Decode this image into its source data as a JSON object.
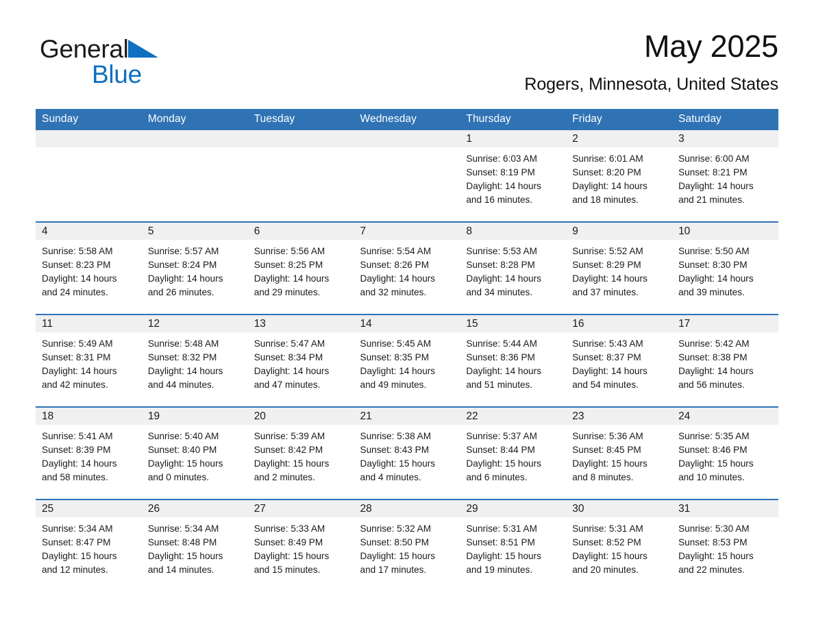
{
  "brand": {
    "name_part1": "General",
    "name_part2": "Blue",
    "triangle_color": "#0f6fc0",
    "text_color": "#1a1a1a"
  },
  "header": {
    "title": "May 2025",
    "subtitle": "Rogers, Minnesota, United States"
  },
  "theme": {
    "header_blue": "#3073b5",
    "row_rule_blue": "#2e72b5",
    "daynum_band": "#f0f0f0",
    "text": "#1a1a1a"
  },
  "weekday_headers": [
    "Sunday",
    "Monday",
    "Tuesday",
    "Wednesday",
    "Thursday",
    "Friday",
    "Saturday"
  ],
  "labels": {
    "sunrise_prefix": "Sunrise:",
    "sunset_prefix": "Sunset:",
    "daylight_prefix": "Daylight:"
  },
  "weeks": [
    [
      {
        "day": "",
        "sunrise": "",
        "sunset": "",
        "daylight_line1": "",
        "daylight_line2": ""
      },
      {
        "day": "",
        "sunrise": "",
        "sunset": "",
        "daylight_line1": "",
        "daylight_line2": ""
      },
      {
        "day": "",
        "sunrise": "",
        "sunset": "",
        "daylight_line1": "",
        "daylight_line2": ""
      },
      {
        "day": "",
        "sunrise": "",
        "sunset": "",
        "daylight_line1": "",
        "daylight_line2": ""
      },
      {
        "day": "1",
        "sunrise": "Sunrise: 6:03 AM",
        "sunset": "Sunset: 8:19 PM",
        "daylight_line1": "Daylight: 14 hours",
        "daylight_line2": "and 16 minutes."
      },
      {
        "day": "2",
        "sunrise": "Sunrise: 6:01 AM",
        "sunset": "Sunset: 8:20 PM",
        "daylight_line1": "Daylight: 14 hours",
        "daylight_line2": "and 18 minutes."
      },
      {
        "day": "3",
        "sunrise": "Sunrise: 6:00 AM",
        "sunset": "Sunset: 8:21 PM",
        "daylight_line1": "Daylight: 14 hours",
        "daylight_line2": "and 21 minutes."
      }
    ],
    [
      {
        "day": "4",
        "sunrise": "Sunrise: 5:58 AM",
        "sunset": "Sunset: 8:23 PM",
        "daylight_line1": "Daylight: 14 hours",
        "daylight_line2": "and 24 minutes."
      },
      {
        "day": "5",
        "sunrise": "Sunrise: 5:57 AM",
        "sunset": "Sunset: 8:24 PM",
        "daylight_line1": "Daylight: 14 hours",
        "daylight_line2": "and 26 minutes."
      },
      {
        "day": "6",
        "sunrise": "Sunrise: 5:56 AM",
        "sunset": "Sunset: 8:25 PM",
        "daylight_line1": "Daylight: 14 hours",
        "daylight_line2": "and 29 minutes."
      },
      {
        "day": "7",
        "sunrise": "Sunrise: 5:54 AM",
        "sunset": "Sunset: 8:26 PM",
        "daylight_line1": "Daylight: 14 hours",
        "daylight_line2": "and 32 minutes."
      },
      {
        "day": "8",
        "sunrise": "Sunrise: 5:53 AM",
        "sunset": "Sunset: 8:28 PM",
        "daylight_line1": "Daylight: 14 hours",
        "daylight_line2": "and 34 minutes."
      },
      {
        "day": "9",
        "sunrise": "Sunrise: 5:52 AM",
        "sunset": "Sunset: 8:29 PM",
        "daylight_line1": "Daylight: 14 hours",
        "daylight_line2": "and 37 minutes."
      },
      {
        "day": "10",
        "sunrise": "Sunrise: 5:50 AM",
        "sunset": "Sunset: 8:30 PM",
        "daylight_line1": "Daylight: 14 hours",
        "daylight_line2": "and 39 minutes."
      }
    ],
    [
      {
        "day": "11",
        "sunrise": "Sunrise: 5:49 AM",
        "sunset": "Sunset: 8:31 PM",
        "daylight_line1": "Daylight: 14 hours",
        "daylight_line2": "and 42 minutes."
      },
      {
        "day": "12",
        "sunrise": "Sunrise: 5:48 AM",
        "sunset": "Sunset: 8:32 PM",
        "daylight_line1": "Daylight: 14 hours",
        "daylight_line2": "and 44 minutes."
      },
      {
        "day": "13",
        "sunrise": "Sunrise: 5:47 AM",
        "sunset": "Sunset: 8:34 PM",
        "daylight_line1": "Daylight: 14 hours",
        "daylight_line2": "and 47 minutes."
      },
      {
        "day": "14",
        "sunrise": "Sunrise: 5:45 AM",
        "sunset": "Sunset: 8:35 PM",
        "daylight_line1": "Daylight: 14 hours",
        "daylight_line2": "and 49 minutes."
      },
      {
        "day": "15",
        "sunrise": "Sunrise: 5:44 AM",
        "sunset": "Sunset: 8:36 PM",
        "daylight_line1": "Daylight: 14 hours",
        "daylight_line2": "and 51 minutes."
      },
      {
        "day": "16",
        "sunrise": "Sunrise: 5:43 AM",
        "sunset": "Sunset: 8:37 PM",
        "daylight_line1": "Daylight: 14 hours",
        "daylight_line2": "and 54 minutes."
      },
      {
        "day": "17",
        "sunrise": "Sunrise: 5:42 AM",
        "sunset": "Sunset: 8:38 PM",
        "daylight_line1": "Daylight: 14 hours",
        "daylight_line2": "and 56 minutes."
      }
    ],
    [
      {
        "day": "18",
        "sunrise": "Sunrise: 5:41 AM",
        "sunset": "Sunset: 8:39 PM",
        "daylight_line1": "Daylight: 14 hours",
        "daylight_line2": "and 58 minutes."
      },
      {
        "day": "19",
        "sunrise": "Sunrise: 5:40 AM",
        "sunset": "Sunset: 8:40 PM",
        "daylight_line1": "Daylight: 15 hours",
        "daylight_line2": "and 0 minutes."
      },
      {
        "day": "20",
        "sunrise": "Sunrise: 5:39 AM",
        "sunset": "Sunset: 8:42 PM",
        "daylight_line1": "Daylight: 15 hours",
        "daylight_line2": "and 2 minutes."
      },
      {
        "day": "21",
        "sunrise": "Sunrise: 5:38 AM",
        "sunset": "Sunset: 8:43 PM",
        "daylight_line1": "Daylight: 15 hours",
        "daylight_line2": "and 4 minutes."
      },
      {
        "day": "22",
        "sunrise": "Sunrise: 5:37 AM",
        "sunset": "Sunset: 8:44 PM",
        "daylight_line1": "Daylight: 15 hours",
        "daylight_line2": "and 6 minutes."
      },
      {
        "day": "23",
        "sunrise": "Sunrise: 5:36 AM",
        "sunset": "Sunset: 8:45 PM",
        "daylight_line1": "Daylight: 15 hours",
        "daylight_line2": "and 8 minutes."
      },
      {
        "day": "24",
        "sunrise": "Sunrise: 5:35 AM",
        "sunset": "Sunset: 8:46 PM",
        "daylight_line1": "Daylight: 15 hours",
        "daylight_line2": "and 10 minutes."
      }
    ],
    [
      {
        "day": "25",
        "sunrise": "Sunrise: 5:34 AM",
        "sunset": "Sunset: 8:47 PM",
        "daylight_line1": "Daylight: 15 hours",
        "daylight_line2": "and 12 minutes."
      },
      {
        "day": "26",
        "sunrise": "Sunrise: 5:34 AM",
        "sunset": "Sunset: 8:48 PM",
        "daylight_line1": "Daylight: 15 hours",
        "daylight_line2": "and 14 minutes."
      },
      {
        "day": "27",
        "sunrise": "Sunrise: 5:33 AM",
        "sunset": "Sunset: 8:49 PM",
        "daylight_line1": "Daylight: 15 hours",
        "daylight_line2": "and 15 minutes."
      },
      {
        "day": "28",
        "sunrise": "Sunrise: 5:32 AM",
        "sunset": "Sunset: 8:50 PM",
        "daylight_line1": "Daylight: 15 hours",
        "daylight_line2": "and 17 minutes."
      },
      {
        "day": "29",
        "sunrise": "Sunrise: 5:31 AM",
        "sunset": "Sunset: 8:51 PM",
        "daylight_line1": "Daylight: 15 hours",
        "daylight_line2": "and 19 minutes."
      },
      {
        "day": "30",
        "sunrise": "Sunrise: 5:31 AM",
        "sunset": "Sunset: 8:52 PM",
        "daylight_line1": "Daylight: 15 hours",
        "daylight_line2": "and 20 minutes."
      },
      {
        "day": "31",
        "sunrise": "Sunrise: 5:30 AM",
        "sunset": "Sunset: 8:53 PM",
        "daylight_line1": "Daylight: 15 hours",
        "daylight_line2": "and 22 minutes."
      }
    ]
  ]
}
